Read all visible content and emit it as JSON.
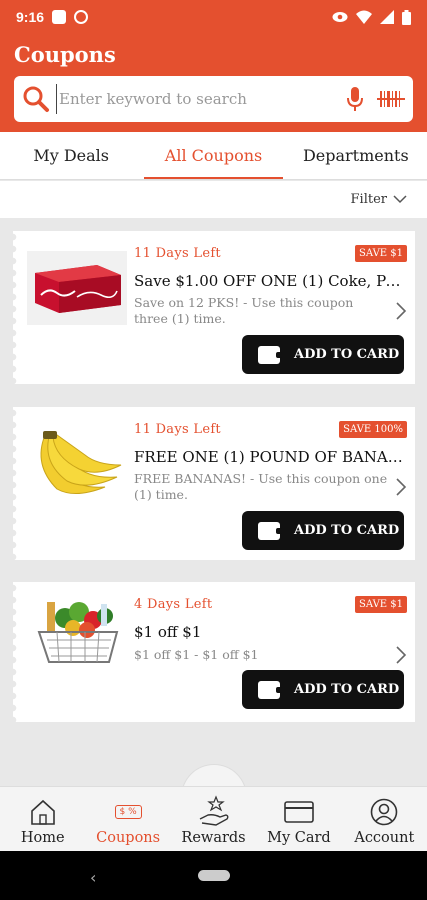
{
  "status_bar": {
    "time": "9:16"
  },
  "app": {
    "title": "Coupons",
    "accent": "#e4502f"
  },
  "search": {
    "placeholder": "Enter keyword to search"
  },
  "tabs": [
    {
      "label": "My Deals",
      "active": false
    },
    {
      "label": "All Coupons",
      "active": true
    },
    {
      "label": "Departments",
      "active": false
    }
  ],
  "filter": {
    "label": "Filter"
  },
  "coupons": [
    {
      "days_left": "11 Days Left",
      "badge": "SAVE $1",
      "title": "Save $1.00 OFF ONE (1) Coke, Peps...",
      "desc": "Save on 12 PKS! - Use this coupon three (1) time.",
      "button": "ADD TO CARD",
      "image": "coke-12pack"
    },
    {
      "days_left": "11 Days Left",
      "badge": "SAVE 100%",
      "title": "FREE ONE (1) POUND OF BANAN...",
      "desc": "FREE BANANAS! - Use this coupon one (1) time.",
      "button": "ADD TO CARD",
      "image": "bananas"
    },
    {
      "days_left": "4 Days Left",
      "badge": "SAVE $1",
      "title": "$1 off $1",
      "desc": "$1 off $1 - $1 off $1",
      "button": "ADD TO CARD",
      "image": "grocery-basket"
    }
  ],
  "bottom_nav": [
    {
      "label": "Home",
      "icon": "home-icon",
      "active": false
    },
    {
      "label": "Coupons",
      "icon": "coupon-icon",
      "active": true,
      "icon_text": "$ %"
    },
    {
      "label": "Rewards",
      "icon": "rewards-icon",
      "active": false
    },
    {
      "label": "My Card",
      "icon": "card-icon",
      "active": false
    },
    {
      "label": "Account",
      "icon": "account-icon",
      "active": false
    }
  ]
}
